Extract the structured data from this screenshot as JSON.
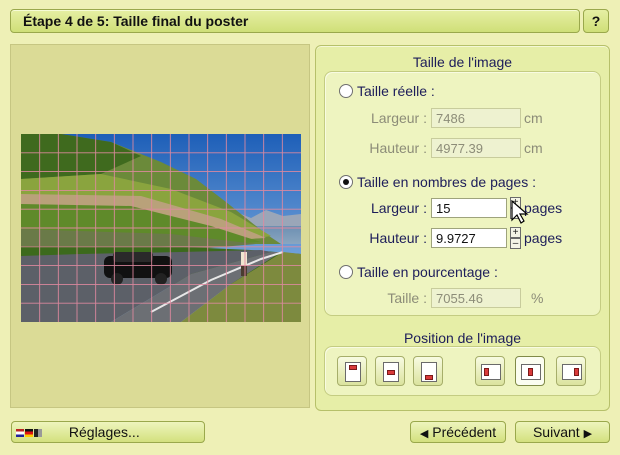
{
  "header": {
    "title": "Étape 4 de 5: Taille final du poster",
    "help_label": "?"
  },
  "image_size": {
    "section_title": "Taille de l'image",
    "real": {
      "label": "Taille réelle :",
      "width_label": "Largeur :",
      "width_value": "7486",
      "width_unit": "cm",
      "height_label": "Hauteur :",
      "height_value": "4977.39",
      "height_unit": "cm"
    },
    "pages": {
      "label": "Taille en nombres de pages :",
      "width_label": "Largeur :",
      "width_value": "15",
      "width_unit": "pages",
      "height_label": "Hauteur :",
      "height_value": "9.9727",
      "height_unit": "pages",
      "spin_up": "+",
      "spin_down": "–"
    },
    "percent": {
      "label": "Taille en pourcentage :",
      "size_label": "Taille :",
      "size_value": "7055.46",
      "size_unit": "%"
    },
    "selected_option": "pages"
  },
  "image_position": {
    "section_title": "Position de l'image",
    "selected_index": 4
  },
  "footer": {
    "settings_label": "Réglages...",
    "prev_label": "Précédent",
    "next_label": "Suivant",
    "prev_icon": "arrow-left",
    "next_icon": "arrow-right"
  },
  "colors": {
    "background": "#eef0b6",
    "grid_line": "#e08aa0",
    "accent": "#d93a3a"
  }
}
